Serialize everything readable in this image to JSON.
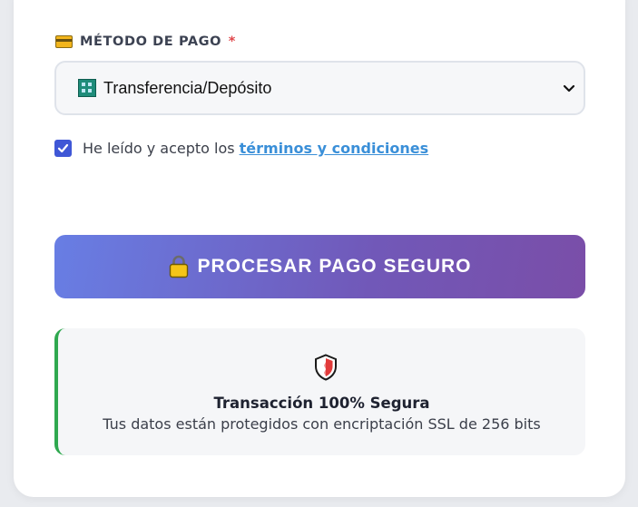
{
  "payment": {
    "label": "MÉTODO DE PAGO",
    "required_mark": "*",
    "label_icon": "credit-card-icon",
    "selected_method": "Transferencia/Depósito",
    "selected_icon": "bank-icon"
  },
  "terms": {
    "checked": true,
    "prefix": "He leído y acepto los",
    "link_text": "términos y condiciones"
  },
  "submit": {
    "icon": "lock-icon",
    "label": "PROCESAR PAGO SEGURO"
  },
  "security": {
    "icon": "shield-icon",
    "title": "Transacción 100% Segura",
    "subtitle": "Tus datos están protegidos con encriptación SSL de 256 bits"
  },
  "colors": {
    "button_gradient_start": "#687ee4",
    "button_gradient_end": "#7a4ea8",
    "link": "#3a8fd8",
    "checkbox": "#3f57d6",
    "required": "#e0474b",
    "secure_border": "#2fa84f"
  }
}
